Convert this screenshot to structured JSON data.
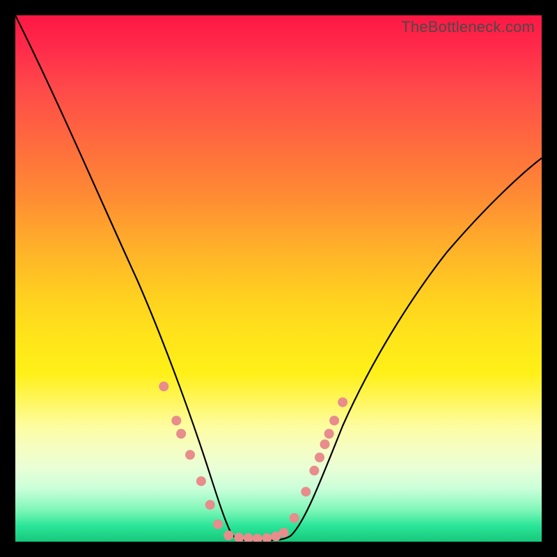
{
  "watermark": {
    "text": "TheBottleneck.com"
  },
  "chart_data": {
    "type": "line",
    "title": "",
    "xlabel": "",
    "ylabel": "",
    "xlim": [
      0,
      100
    ],
    "ylim": [
      0,
      100
    ],
    "series": [
      {
        "name": "bottleneck-curve",
        "x": [
          0,
          5,
          10,
          15,
          20,
          25,
          28,
          31,
          34,
          37,
          38.5,
          40,
          42,
          45,
          48,
          50,
          53,
          55,
          58,
          62,
          68,
          75,
          82,
          90,
          100
        ],
        "y": [
          100,
          90,
          79,
          67,
          55,
          42,
          34,
          26,
          18,
          9,
          4,
          1,
          0,
          0,
          0,
          1,
          5,
          10,
          17,
          26,
          37,
          47,
          55,
          62,
          70
        ]
      }
    ],
    "markers": {
      "name": "scatter-dots",
      "color": "#e88c8c",
      "points": [
        {
          "x": 28.2,
          "y": 29.5
        },
        {
          "x": 30.6,
          "y": 23.0
        },
        {
          "x": 31.5,
          "y": 20.5
        },
        {
          "x": 33.2,
          "y": 16.5
        },
        {
          "x": 35.3,
          "y": 11.5
        },
        {
          "x": 37.0,
          "y": 7.0
        },
        {
          "x": 38.5,
          "y": 3.3
        },
        {
          "x": 40.5,
          "y": 1.2
        },
        {
          "x": 42.5,
          "y": 0.8
        },
        {
          "x": 44.3,
          "y": 0.7
        },
        {
          "x": 46.0,
          "y": 0.6
        },
        {
          "x": 47.8,
          "y": 0.7
        },
        {
          "x": 49.5,
          "y": 1.0
        },
        {
          "x": 51.0,
          "y": 1.7
        },
        {
          "x": 53.0,
          "y": 4.5
        },
        {
          "x": 55.2,
          "y": 9.5
        },
        {
          "x": 56.8,
          "y": 13.5
        },
        {
          "x": 57.8,
          "y": 16.0
        },
        {
          "x": 58.8,
          "y": 18.5
        },
        {
          "x": 59.6,
          "y": 20.5
        },
        {
          "x": 60.6,
          "y": 23.0
        },
        {
          "x": 62.2,
          "y": 26.5
        }
      ]
    }
  }
}
